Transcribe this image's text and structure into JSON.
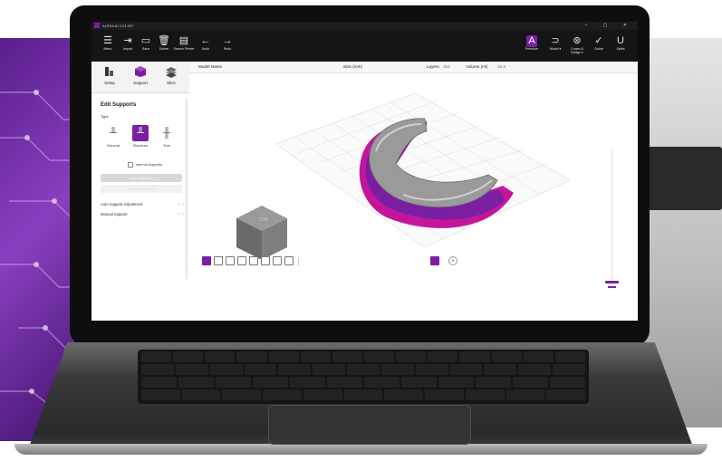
{
  "app": {
    "title": "ALPHA AI 3.21.007",
    "window_controls": "–  ▢  ✕"
  },
  "toolbar": {
    "left": [
      {
        "label": "Menu",
        "icon": "menu-icon",
        "glyph": "☰"
      },
      {
        "label": "Import",
        "icon": "import-icon",
        "glyph": "⇥"
      },
      {
        "label": "Save",
        "icon": "save-icon",
        "glyph": "▭"
      },
      {
        "label": "Delete",
        "icon": "delete-icon",
        "glyph": "🗑"
      },
      {
        "label": "Search Printer",
        "icon": "printer-search-icon",
        "glyph": "▤"
      },
      {
        "label": "Undo",
        "icon": "undo-icon",
        "glyph": "←"
      },
      {
        "label": "Redo",
        "icon": "redo-icon",
        "glyph": "→"
      }
    ],
    "right": [
      {
        "label": "Premium",
        "icon": "premium-icon",
        "glyph": "A"
      },
      {
        "label": "Model ▾",
        "icon": "model-icon",
        "glyph": "⊃"
      },
      {
        "label": "Crown & Bridge ▾",
        "icon": "crown-bridge-icon",
        "glyph": "⊛"
      },
      {
        "label": "Guide",
        "icon": "guide-icon",
        "glyph": "✓"
      },
      {
        "label": "Splint",
        "icon": "splint-icon",
        "glyph": "U"
      }
    ]
  },
  "sidebar": {
    "tabs": [
      {
        "label": "Setup",
        "icon": "printer-setup-icon"
      },
      {
        "label": "Support",
        "icon": "support-cube-icon"
      },
      {
        "label": "Slice",
        "icon": "slice-layers-icon"
      }
    ],
    "section_title": "Edit Supports",
    "type_label": "Type",
    "support_types": [
      {
        "label": "General",
        "icon": "general-support-icon",
        "glyph": "╨"
      },
      {
        "label": "Structure",
        "icon": "structure-support-icon",
        "glyph": "╨"
      },
      {
        "label": "Tree",
        "icon": "tree-support-icon",
        "glyph": "╫"
      }
    ],
    "internal_supports_label": "Internal Supports",
    "auto_supports_label": "Auto Supports",
    "manual_supports_label": "Manual Supports",
    "accordions": [
      {
        "label": "Auto Support Adjustment",
        "toggle": "+ ⃝"
      },
      {
        "label": "Manual Support",
        "toggle": "+ ⃝"
      }
    ]
  },
  "header": {
    "model_name": "Model Name",
    "size": "Size (mm)",
    "layers_label": "Layers",
    "layers_value": "152",
    "volume_label": "Volume (ml)",
    "volume_value": "16.3"
  },
  "view_cube": {
    "top": "TOP",
    "front": "FRONT",
    "right": "RIGHT"
  },
  "view_buttons": [
    {
      "name": "view-iso-button",
      "active": true
    },
    {
      "name": "view-front-button",
      "active": false
    },
    {
      "name": "view-back-button",
      "active": false
    },
    {
      "name": "view-left-button",
      "active": false
    },
    {
      "name": "view-right-button",
      "active": false
    },
    {
      "name": "view-top-button",
      "active": false
    },
    {
      "name": "view-bottom-button",
      "active": false
    },
    {
      "name": "view-fit-button",
      "active": false
    }
  ],
  "colors": {
    "accent": "#7b1fa2",
    "magenta": "#c4169b",
    "toolbar_bg": "#151515"
  }
}
